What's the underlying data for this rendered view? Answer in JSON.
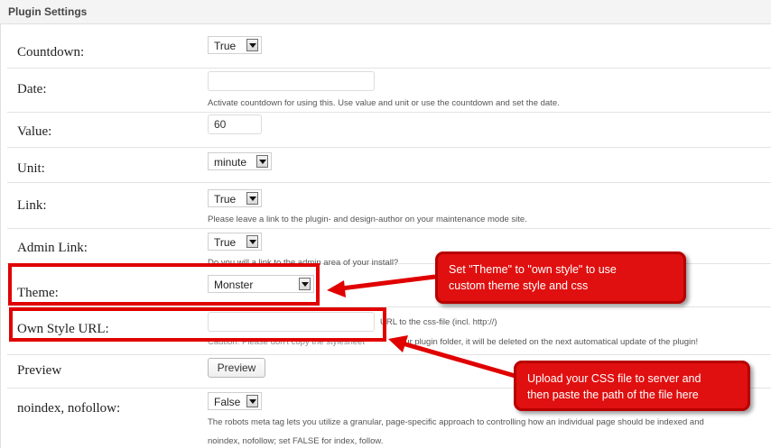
{
  "panel": {
    "title": "Plugin Settings"
  },
  "rows": {
    "countdown": {
      "label": "Countdown:",
      "value": "True"
    },
    "date": {
      "label": "Date:",
      "value": "",
      "hint": "Activate countdown for using this. Use value and unit or use the countdown and set the date."
    },
    "value": {
      "label": "Value:",
      "value": "60"
    },
    "unit": {
      "label": "Unit:",
      "value": "minute"
    },
    "link": {
      "label": "Link:",
      "value": "True",
      "hint": "Please leave a link to the plugin- and design-author on your maintenance mode site."
    },
    "admin_link": {
      "label": "Admin Link:",
      "value": "True",
      "hint": "Do you will a link to the admin area of your install?"
    },
    "theme": {
      "label": "Theme:",
      "value": "Monster"
    },
    "own_style_url": {
      "label": "Own Style URL:",
      "value": "",
      "hint": "URL to the css-file (incl. http://)",
      "caution_prefix": "Caution: Please don't copy the stylesheet",
      "caution_suffix": "our plugin folder, it will be deleted on the next automatical update of the plugin!"
    },
    "preview": {
      "label": "Preview",
      "button": "Preview"
    },
    "noindex": {
      "label": "noindex, nofollow:",
      "value": "False",
      "hint_line1": "The robots meta tag lets you utilize a granular, page-specific approach to controlling how an individual page should be indexed and",
      "hint_line2": "noindex, nofollow; set FALSE for index, follow."
    }
  },
  "annotations": {
    "theme_note": {
      "line1": "Set \"Theme\" to \"own style\" to use",
      "line2": "custom theme style and css"
    },
    "upload_note": {
      "line1": "Upload your CSS file to server and",
      "line2": "then paste the path of the file here"
    }
  },
  "colors": {
    "annotation_red": "#e00000",
    "annotation_fill": "#e01010"
  },
  "icons": {
    "select_arrow": "chevron-down-icon"
  }
}
